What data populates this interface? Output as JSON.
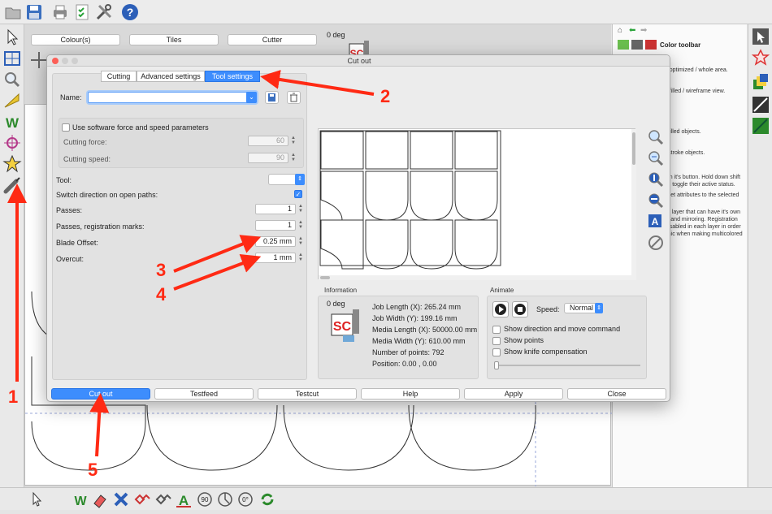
{
  "top_toolbar": {
    "icons": [
      "open-folder-icon",
      "save-icon",
      "print-icon",
      "checklist-icon",
      "tools-icon",
      "help-icon"
    ]
  },
  "properties_bar": {
    "colour_label": "Colour(s)",
    "tiles_label": "Tiles",
    "cutter_label": "Cutter",
    "rotation_label": "0 deg",
    "logo_text": "SC"
  },
  "color_panel": {
    "title": "Color toolbar",
    "lines": [
      "en optimized / whole area.",
      "en filled / wireframe view.",
      "rs.",
      "or filled objects.",
      "or stroke objects.",
      "g on it's button. Hold down shift",
      "s to toggle their active status.",
      "to set attributes to the selected",
      "is a layer that can have it's own",
      "ion and mirroring. Registration",
      "r disabled in each layer in order",
      "aphic when making multicolored"
    ]
  },
  "dialog": {
    "title": "Cut out",
    "tabs": [
      {
        "label": "Cutting",
        "active": false
      },
      {
        "label": "Advanced settings",
        "active": false
      },
      {
        "label": "Tool settings",
        "active": true
      }
    ],
    "name_label": "Name:",
    "name_value": "",
    "use_software_force_label": "Use software force and speed parameters",
    "use_software_force_checked": false,
    "cutting_force_label": "Cutting force:",
    "cutting_force_value": "60",
    "cutting_speed_label": "Cutting speed:",
    "cutting_speed_value": "90",
    "tool_label": "Tool:",
    "switch_direction_label": "Switch direction on open paths:",
    "switch_direction_checked": true,
    "passes_label": "Passes:",
    "passes_value": "1",
    "passes_reg_label": "Passes, registration marks:",
    "passes_reg_value": "1",
    "blade_offset_label": "Blade Offset:",
    "blade_offset_value": "0.25 mm",
    "overcut_label": "Overcut:",
    "overcut_value": "1 mm",
    "information": {
      "title": "Information",
      "rotation_label": "0 deg",
      "logo_text": "SC",
      "job_length": "Job Length (X): 265.24 mm",
      "job_width": "Job Width (Y): 199.16 mm",
      "media_length": "Media Length (X): 50000.00 mm",
      "media_width": "Media Width (Y): 610.00 mm",
      "num_points": "Number of points: 792",
      "position": "Position: 0.00 , 0.00"
    },
    "animate": {
      "title": "Animate",
      "speed_label": "Speed:",
      "speed_value": "Normal",
      "show_direction_label": "Show direction and move command",
      "show_points_label": "Show points",
      "show_knife_label": "Show knife compensation"
    },
    "footer": {
      "cut_out": "Cut out",
      "testfeed": "Testfeed",
      "testcut": "Testcut",
      "help": "Help",
      "apply": "Apply",
      "close": "Close"
    }
  },
  "bottom_toolbar": {
    "rotate_90_label": "90",
    "rotate_0_label": "0°"
  },
  "annotations": {
    "n1": "1",
    "n2": "2",
    "n3": "3",
    "n4": "4",
    "n5": "5",
    "color": "#ff2a14"
  },
  "accent_color": "#3d8dfd"
}
